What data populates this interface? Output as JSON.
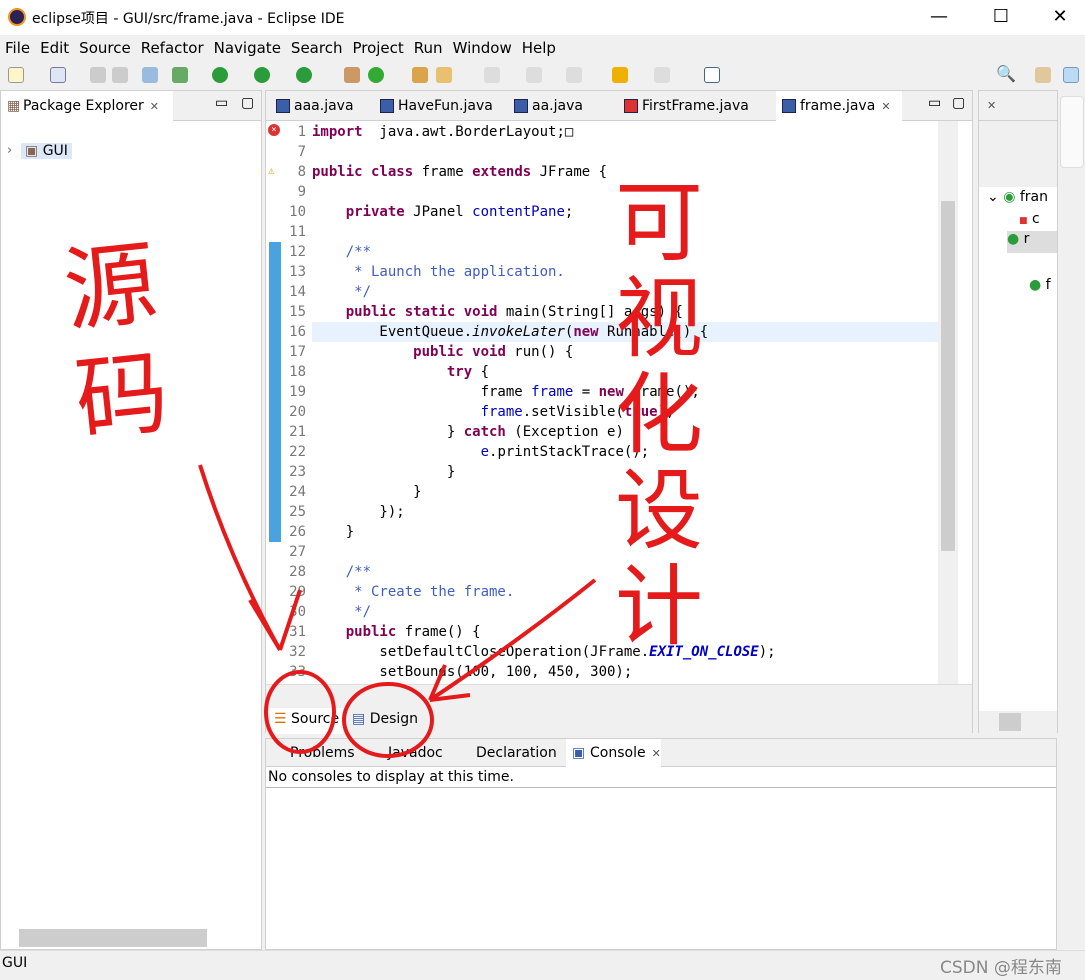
{
  "window": {
    "title": "eclipse项目 - GUI/src/frame.java - Eclipse IDE",
    "controls": [
      "—",
      "☐",
      "✕"
    ]
  },
  "menu": [
    "File",
    "Edit",
    "Source",
    "Refactor",
    "Navigate",
    "Search",
    "Project",
    "Run",
    "Window",
    "Help"
  ],
  "package_explorer": {
    "title": "Package Explorer",
    "tree": [
      {
        "label": "GUI"
      }
    ]
  },
  "editor": {
    "tabs": [
      {
        "label": "aaa.java"
      },
      {
        "label": "HaveFun.java"
      },
      {
        "label": "aa.java"
      },
      {
        "label": "FirstFrame.java",
        "error": true
      },
      {
        "label": "frame.java",
        "active": true
      }
    ],
    "lines": [
      {
        "n": "1",
        "t": [
          [
            "kw",
            "import"
          ],
          [
            "",
            "  java.awt.BorderLayout;"
          ],
          [
            "",
            "□"
          ]
        ]
      },
      {
        "n": "7",
        "t": []
      },
      {
        "n": "8",
        "t": [
          [
            "kw",
            "public class"
          ],
          [
            "",
            " frame "
          ],
          [
            "kw",
            "extends"
          ],
          [
            "",
            " JFrame {"
          ]
        ]
      },
      {
        "n": "9",
        "t": []
      },
      {
        "n": "10",
        "t": [
          [
            "",
            "    "
          ],
          [
            "kw",
            "private"
          ],
          [
            "",
            " JPanel "
          ],
          [
            "fd",
            "contentPane"
          ],
          [
            "",
            ";"
          ]
        ]
      },
      {
        "n": "11",
        "t": []
      },
      {
        "n": "12",
        "t": [
          [
            "jd",
            "    /**"
          ]
        ]
      },
      {
        "n": "13",
        "t": [
          [
            "jd",
            "     * Launch the application."
          ]
        ]
      },
      {
        "n": "14",
        "t": [
          [
            "jd",
            "     */"
          ]
        ]
      },
      {
        "n": "15",
        "t": [
          [
            "",
            "    "
          ],
          [
            "kw",
            "public static void"
          ],
          [
            "",
            " main(String[] args) {"
          ]
        ]
      },
      {
        "n": "16",
        "t": [
          [
            "",
            "        EventQueue."
          ],
          [
            "st",
            "invokeLater"
          ],
          [
            "",
            "("
          ],
          [
            "kw",
            "new"
          ],
          [
            "",
            " Runnable() {"
          ]
        ],
        "hl": true
      },
      {
        "n": "17",
        "t": [
          [
            "",
            "            "
          ],
          [
            "kw",
            "public void"
          ],
          [
            "",
            " run() {"
          ]
        ]
      },
      {
        "n": "18",
        "t": [
          [
            "",
            "                "
          ],
          [
            "kw",
            "try"
          ],
          [
            "",
            " {"
          ]
        ]
      },
      {
        "n": "19",
        "t": [
          [
            "",
            "                    frame "
          ],
          [
            "fd",
            "frame"
          ],
          [
            "",
            " = "
          ],
          [
            "kw",
            "new"
          ],
          [
            "",
            " frame();"
          ]
        ]
      },
      {
        "n": "20",
        "t": [
          [
            "",
            "                    "
          ],
          [
            "fd",
            "frame"
          ],
          [
            "",
            ".setVisible("
          ],
          [
            "kw",
            "true"
          ],
          [
            "",
            ");"
          ]
        ]
      },
      {
        "n": "21",
        "t": [
          [
            "",
            "                } "
          ],
          [
            "kw",
            "catch"
          ],
          [
            "",
            " (Exception e) {"
          ]
        ]
      },
      {
        "n": "22",
        "t": [
          [
            "",
            "                    "
          ],
          [
            "fd",
            "e"
          ],
          [
            "",
            ".printStackTrace();"
          ]
        ]
      },
      {
        "n": "23",
        "t": [
          [
            "",
            "                }"
          ]
        ]
      },
      {
        "n": "24",
        "t": [
          [
            "",
            "            }"
          ]
        ]
      },
      {
        "n": "25",
        "t": [
          [
            "",
            "        });"
          ]
        ]
      },
      {
        "n": "26",
        "t": [
          [
            "",
            "    }"
          ]
        ]
      },
      {
        "n": "27",
        "t": []
      },
      {
        "n": "28",
        "t": [
          [
            "jd",
            "    /**"
          ]
        ]
      },
      {
        "n": "29",
        "t": [
          [
            "jd",
            "     * Create the frame."
          ]
        ]
      },
      {
        "n": "30",
        "t": [
          [
            "jd",
            "     */"
          ]
        ]
      },
      {
        "n": "31",
        "t": [
          [
            "",
            "    "
          ],
          [
            "kw",
            "public"
          ],
          [
            "",
            " frame() {"
          ]
        ]
      },
      {
        "n": "32",
        "t": [
          [
            "",
            "        setDefaultCloseOperation(JFrame."
          ],
          [
            "sf",
            "EXIT_ON_CLOSE"
          ],
          [
            "",
            ");"
          ]
        ]
      },
      {
        "n": "33",
        "t": [
          [
            "",
            "        setBounds(100, 100, 450, 300);"
          ]
        ]
      }
    ],
    "bottom_tabs": {
      "source": "Source",
      "design": "Design"
    }
  },
  "outline": {
    "items": [
      "fran",
      "c",
      "r",
      "",
      "f"
    ]
  },
  "console": {
    "tabs": [
      "Problems",
      "Javadoc",
      "Declaration",
      "Console"
    ],
    "message": "No consoles to display at this time."
  },
  "status": {
    "left": "GUI",
    "watermark": "CSDN @程东南"
  },
  "annotations": {
    "left": "源码",
    "right": "可视化设计"
  },
  "colors": {
    "annotation": "#e51a1a",
    "keyword": "#7f0055",
    "field": "#0000c0",
    "javadoc": "#3f5fbf"
  }
}
